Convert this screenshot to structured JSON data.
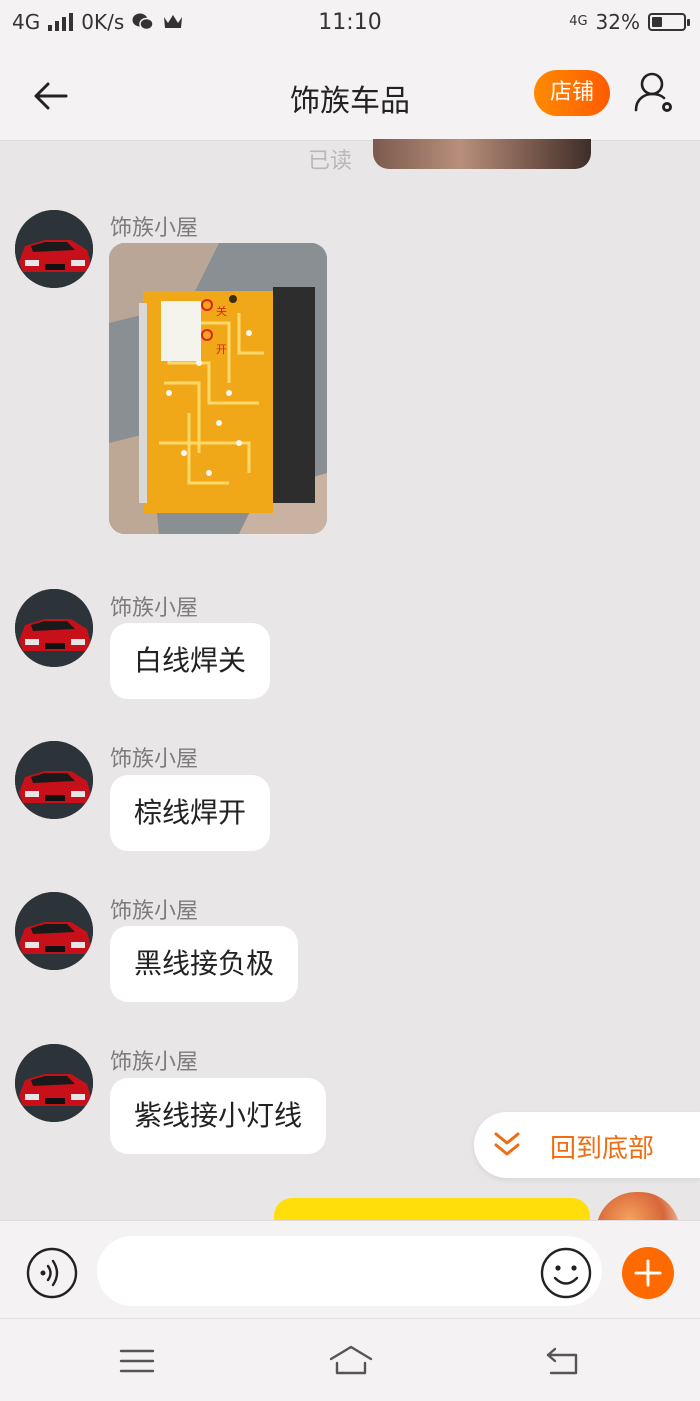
{
  "status_bar": {
    "network": "4G",
    "speed": "0K/s",
    "time": "11:10",
    "network_right": "4G",
    "battery": "32%",
    "battery_level": 0.32
  },
  "header": {
    "title": "饰族车品",
    "shop_label": "店铺"
  },
  "messages": {
    "read_tag": "已读",
    "items": [
      {
        "sender": "饰族小屋",
        "type": "image"
      },
      {
        "sender": "饰族小屋",
        "text": "白线焊关"
      },
      {
        "sender": "饰族小屋",
        "text": "棕线焊开"
      },
      {
        "sender": "饰族小屋",
        "text": "黑线接负极"
      },
      {
        "sender": "饰族小屋",
        "text": "紫线接小灯线"
      }
    ],
    "image_labels": {
      "off": "关",
      "on": "开"
    }
  },
  "back_to_bottom": {
    "label": "回到底部",
    "icon": "double-chevron-down-icon"
  },
  "input_bar": {
    "placeholder": "",
    "value": "",
    "icons": [
      "voice-icon",
      "emoji-icon",
      "plus-icon"
    ]
  },
  "nav_bar": {
    "icons": [
      "menu-icon",
      "home-icon",
      "back-icon"
    ]
  },
  "colors": {
    "accent": "#ff6a00",
    "bubble": "#ffffff",
    "background": "#e8e6e7",
    "self_bubble": "#ffde0a"
  }
}
